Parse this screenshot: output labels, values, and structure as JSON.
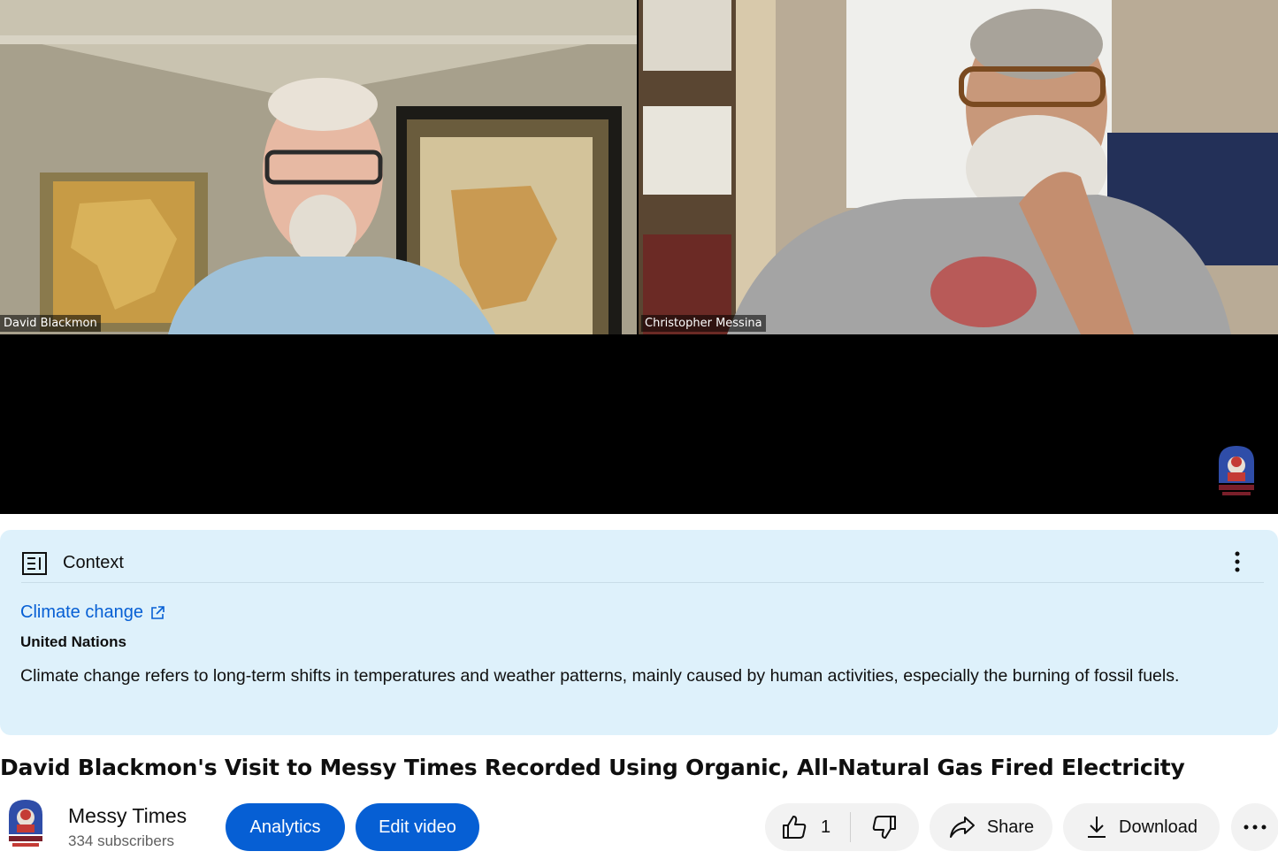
{
  "player": {
    "participants": [
      {
        "name": "David Blackmon"
      },
      {
        "name": "Christopher Messina"
      }
    ],
    "watermark_icon": "messy-times-logo"
  },
  "context_panel": {
    "icon": "context-article-icon",
    "title": "Context",
    "link_label": "Climate change",
    "source": "United Nations",
    "body": "Climate change refers to long-term shifts in temperatures and weather patterns, mainly caused by human activities, especially the burning of fossil fuels."
  },
  "video": {
    "title": "David Blackmon's Visit to Messy Times Recorded Using Organic, All-Natural Gas Fired Electricity"
  },
  "channel": {
    "name": "Messy Times",
    "subscribers": "334 subscribers"
  },
  "actions": {
    "analytics": "Analytics",
    "edit_video": "Edit video",
    "like_count": "1",
    "share": "Share",
    "download": "Download"
  },
  "colors": {
    "accent": "#065fd4",
    "context_bg": "#def1fb",
    "pill_grey": "#f2f2f2"
  }
}
